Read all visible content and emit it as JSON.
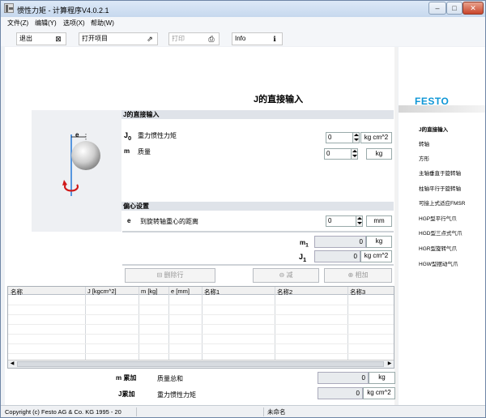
{
  "titlebar": {
    "title": "惯性力矩 - 计算程序V4.0.2.1",
    "minimize": "–",
    "maximize": "□",
    "close": "✕"
  },
  "menu": [
    {
      "label": "文件(Z)"
    },
    {
      "label": "编辑(Y)"
    },
    {
      "label": "选项(X)"
    },
    {
      "label": "帮助(W)"
    }
  ],
  "toolbar": {
    "exit_label": "退出",
    "open_label": "打开项目",
    "print_label": "打印",
    "info_label": "Info"
  },
  "page": {
    "title": "J的直接输入"
  },
  "brand": {
    "logo_text": "FESTO",
    "color": "#0d96d6"
  },
  "nav": [
    {
      "label": "J的直接输入",
      "active": true
    },
    {
      "label": "转轴"
    },
    {
      "label": "方形"
    },
    {
      "label": "主轴垂直于旋转轴"
    },
    {
      "label": "柱轴平行于旋转轴"
    },
    {
      "label": "可接上式适应FMSR"
    },
    {
      "label": "HGP型平行气爪"
    },
    {
      "label": "HGD型三点式气爪"
    },
    {
      "label": "HGR型旋转气爪"
    },
    {
      "label": "HGW型摆动气爪"
    }
  ],
  "direct_input": {
    "section_title": "J的直接输入",
    "j0_symbol": "J",
    "j0_sub": "0",
    "j0_label": "重力惯性力矩",
    "j0_value": "0",
    "j0_unit": "kg cm^2",
    "m_symbol": "m",
    "m_label": "质量",
    "m_value": "0",
    "m_unit": "kg"
  },
  "eccentric": {
    "section_title": "偏心设置",
    "e_symbol": "e",
    "e_label": "到旋转轴重心的距离",
    "e_value": "0",
    "e_unit": "mm"
  },
  "diagram": {
    "e_label": "e"
  },
  "results": {
    "m1_symbol": "m",
    "m1_sub": "1",
    "m1_value": "0",
    "m1_unit": "kg",
    "j1_symbol": "J",
    "j1_sub": "1",
    "j1_value": "0",
    "j1_unit": "kg cm^2"
  },
  "actions": {
    "delete_row": "删除行",
    "subtract": "减",
    "add": "相加"
  },
  "table": {
    "columns": [
      "名称",
      "J [kgcm^2]",
      "m [kg]",
      "e [mm]",
      "名称1",
      "名称2",
      "名称3"
    ]
  },
  "totals": {
    "m_sum_symbol": "m 累加",
    "m_sum_label": "质量总和",
    "m_sum_value": "0",
    "m_sum_unit": "kg",
    "j_sum_symbol": "J累加",
    "j_sum_label": "重力惯性力矩",
    "j_sum_value": "0",
    "j_sum_unit": "kg cm^2"
  },
  "status": {
    "copyright": "Copyright (c) Festo AG & Co. KG 1995 - 20",
    "filename": "未命名"
  }
}
